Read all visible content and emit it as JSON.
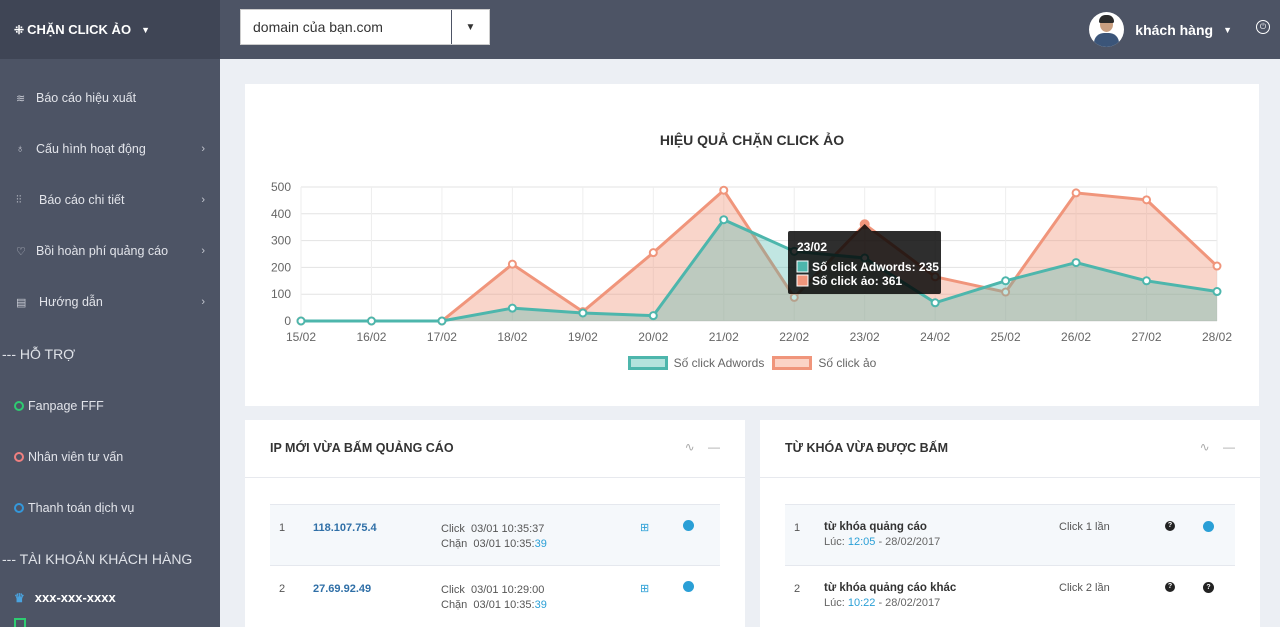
{
  "topbar": {
    "brand_icon": "⁜",
    "brand": "CHẶN CLICK ẢO",
    "domain": "domain của bạn.com",
    "user_name": "khách hàng"
  },
  "sidebar": {
    "items": [
      {
        "label": "Báo cáo hiệu xuất",
        "icon": "layers-icon"
      },
      {
        "label": "Cấu hình hoạt động",
        "icon": "pin-icon"
      },
      {
        "label": "Báo cáo chi tiết",
        "icon": "sliders-icon"
      },
      {
        "label": "Bồi hoàn phí quảng cáo",
        "icon": "heart-icon"
      },
      {
        "label": "Hướng dẫn",
        "icon": "book-icon"
      }
    ],
    "support_title": "--- HỖ TRỢ",
    "support": [
      {
        "label": "Fanpage FFF",
        "color": "#2ecc71"
      },
      {
        "label": "Nhân viên tư vấn",
        "color": "#f08080"
      },
      {
        "label": "Thanh toán dịch vụ",
        "color": "#3498db"
      }
    ],
    "account_title": "--- TÀI KHOẢN KHÁCH HÀNG",
    "account_id": "xxx-xxx-xxxx"
  },
  "chart_data": {
    "type": "area",
    "title": "HIỆU QUẢ CHẶN CLICK ẢO",
    "categories": [
      "15/02",
      "16/02",
      "17/02",
      "18/02",
      "19/02",
      "20/02",
      "21/02",
      "22/02",
      "23/02",
      "24/02",
      "25/02",
      "26/02",
      "27/02",
      "28/02"
    ],
    "series": [
      {
        "name": "Số click Adwords",
        "color": "#4db6ac",
        "values": [
          0,
          0,
          0,
          48,
          30,
          20,
          378,
          260,
          235,
          68,
          150,
          218,
          150,
          110
        ]
      },
      {
        "name": "Số click ảo",
        "color": "#f0957b",
        "values": [
          0,
          0,
          0,
          212,
          35,
          255,
          488,
          88,
          361,
          165,
          108,
          478,
          452,
          205
        ]
      }
    ],
    "ylim": [
      0,
      500
    ],
    "yticks": [
      0,
      100,
      200,
      300,
      400,
      500
    ],
    "grid": true,
    "legend": "bottom",
    "tooltip": {
      "category": "23/02",
      "lines": [
        "Số click Adwords: 235",
        "Số click ảo: 361"
      ]
    }
  },
  "ip_panel": {
    "title": "IP MỚI VỪA BẤM QUẢNG CÁO",
    "rows": [
      {
        "num": "1",
        "ip": "118.107.75.4",
        "click_label": "Click",
        "click_time": "03/01 10:35:37",
        "block_label": "Chặn",
        "block_time_prefix": "03/01 10:35:",
        "block_time_sec": "39"
      },
      {
        "num": "2",
        "ip": "27.69.92.49",
        "click_label": "Click",
        "click_time": "03/01 10:29:00",
        "block_label": "Chặn",
        "block_time_prefix": "03/01 10:35:",
        "block_time_sec": "39"
      }
    ]
  },
  "kw_panel": {
    "title": "TỪ KHÓA VỪA ĐƯỢC BẤM",
    "rows": [
      {
        "num": "1",
        "keyword": "từ khóa quảng cáo",
        "time_label": "Lúc:",
        "time": "12:05",
        "date": " - 28/02/2017",
        "clicks": "Click 1 lần"
      },
      {
        "num": "2",
        "keyword": "từ khóa quảng cáo khác",
        "time_label": "Lúc:",
        "time": "10:22",
        "date": " - 28/02/2017",
        "clicks": "Click 2 lần"
      }
    ]
  }
}
